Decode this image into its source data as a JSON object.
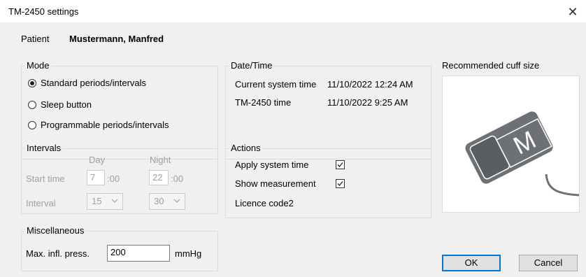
{
  "window": {
    "title": "TM-2450 settings",
    "close_glyph": "✕"
  },
  "patient": {
    "label": "Patient",
    "name": "Mustermann, Manfred"
  },
  "mode": {
    "legend": "Mode",
    "options": [
      {
        "label": "Standard periods/intervals",
        "selected": true
      },
      {
        "label": "Sleep button",
        "selected": false
      },
      {
        "label": "Programmable periods/intervals",
        "selected": false
      }
    ]
  },
  "datetime": {
    "legend": "Date/Time",
    "rows": [
      {
        "label": "Current system time",
        "value": "11/10/2022 12:24 AM"
      },
      {
        "label": "TM-2450 time",
        "value": "11/10/2022 9:25 AM"
      }
    ]
  },
  "cuff": {
    "title": "Recommended cuff size",
    "letter": "M",
    "icon": "cuff-size-m-icon"
  },
  "intervals": {
    "legend": "Intervals",
    "day_label": "Day",
    "night_label": "Night",
    "start_label": "Start time",
    "interval_label": "Interval",
    "day_start_hour": "7",
    "day_start_minutes": ":00",
    "night_start_hour": "22",
    "night_start_minutes": ":00",
    "day_interval": "15",
    "night_interval": "30"
  },
  "actions": {
    "legend": "Actions",
    "apply_label": "Apply system time",
    "apply_checked": true,
    "show_label": "Show measurement",
    "show_checked": true,
    "licence_label": "Licence code2"
  },
  "misc": {
    "legend": "Miscellaneous",
    "max_label": "Max. infl. press.",
    "max_value": "200",
    "unit": "mmHg"
  },
  "buttons": {
    "ok": "OK",
    "cancel": "Cancel"
  },
  "colors": {
    "focus_border": "#0078d7",
    "cuff_gray": "#6d7176",
    "background": "#f0f0f0"
  }
}
